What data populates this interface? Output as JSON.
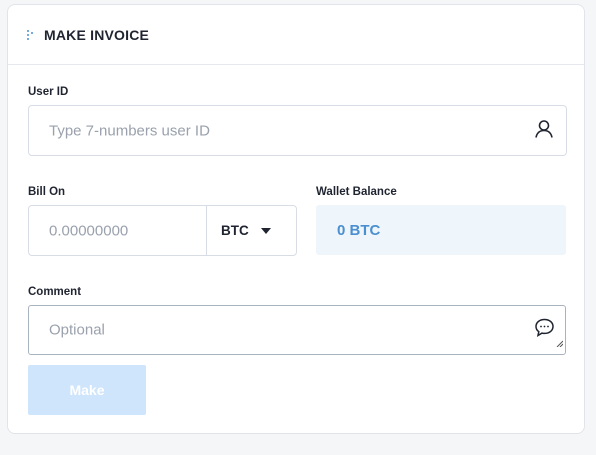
{
  "card": {
    "title": "MAKE INVOICE"
  },
  "user_id": {
    "label": "User ID",
    "placeholder": "Type 7-numbers user ID",
    "icon": "user-icon"
  },
  "bill_on": {
    "label": "Bill On",
    "placeholder": "0.00000000",
    "currency": "BTC",
    "dropdown_icon": "caret-down-icon"
  },
  "wallet": {
    "label": "Wallet Balance",
    "value": "0 BTC"
  },
  "comment": {
    "label": "Comment",
    "placeholder": "Optional",
    "icon": "speech-bubble-icon"
  },
  "actions": {
    "make_label": "Make"
  },
  "colors": {
    "accent": "#4a8fd0",
    "wallet_bg": "#eef5fb",
    "button_disabled_bg": "#cfe5fb"
  }
}
